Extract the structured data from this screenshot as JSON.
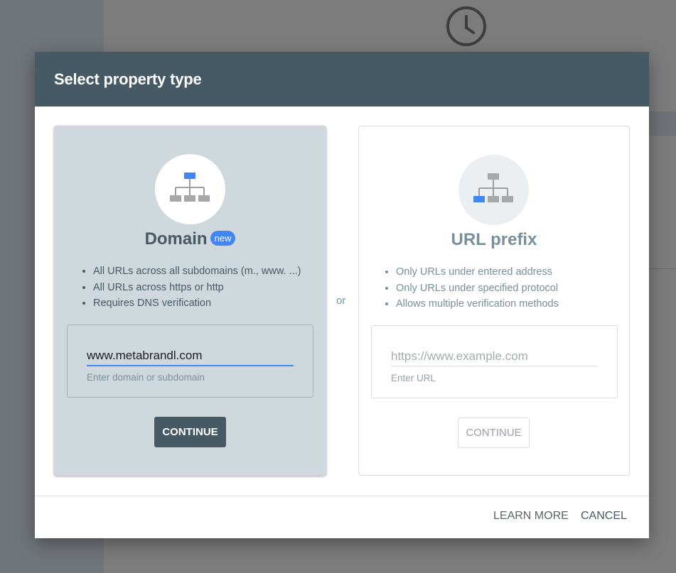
{
  "dialog": {
    "title": "Select property type",
    "or_label": "or",
    "footer": {
      "learn_more_label": "LEARN MORE",
      "cancel_label": "CANCEL"
    }
  },
  "domain_card": {
    "title": "Domain",
    "badge": "new",
    "features": [
      "All URLs across all subdomains (m., www. ...)",
      "All URLs across https or http",
      "Requires DNS verification"
    ],
    "input_value": "www.metabrandl.com",
    "input_help": "Enter domain or subdomain",
    "continue_label": "CONTINUE"
  },
  "url_prefix_card": {
    "title": "URL prefix",
    "features": [
      "Only URLs under entered address",
      "Only URLs under specified protocol",
      "Allows multiple verification methods"
    ],
    "input_placeholder": "https://www.example.com",
    "input_help": "Enter URL",
    "continue_label": "CONTINUE"
  },
  "colors": {
    "header_bg": "#455a64",
    "selected_card_bg": "#cfd8dc",
    "accent_blue": "#4285f4"
  }
}
